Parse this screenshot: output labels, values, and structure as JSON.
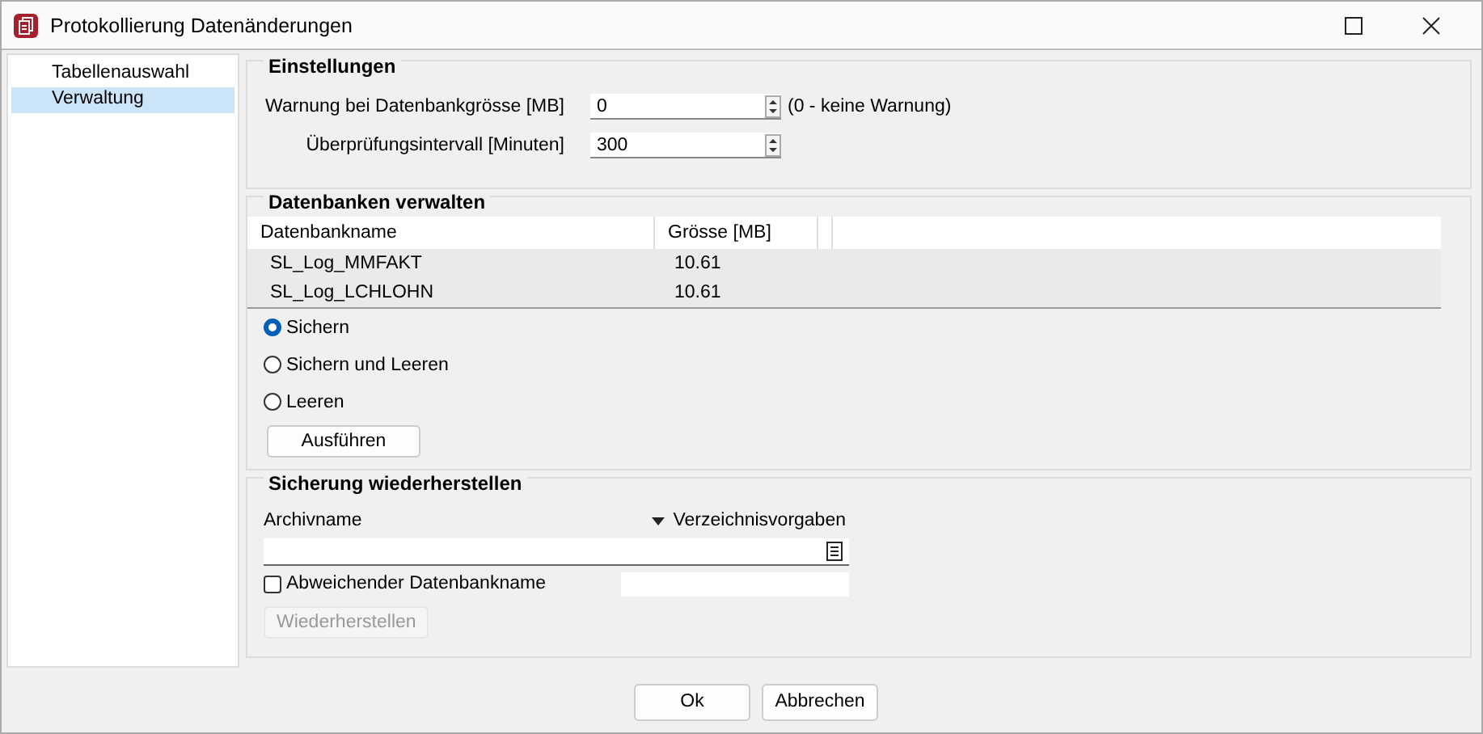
{
  "window": {
    "title": "Protokollierung Datenänderungen"
  },
  "sidebar": {
    "items": [
      {
        "label": "Tabellenauswahl",
        "selected": false
      },
      {
        "label": "Verwaltung",
        "selected": true
      }
    ]
  },
  "settings": {
    "title": "Einstellungen",
    "fields": [
      {
        "label": "Warnung bei Datenbankgrösse [MB]",
        "value": "0",
        "hint": "(0 - keine Warnung)"
      },
      {
        "label": "Überprüfungsintervall [Minuten]",
        "value": "300"
      }
    ]
  },
  "databases": {
    "title": "Datenbanken verwalten",
    "table": {
      "columns": [
        "Datenbankname",
        "Grösse [MB]"
      ],
      "rows": [
        [
          "SL_Log_MMFAKT",
          "10.61"
        ],
        [
          "SL_Log_LCHLOHN",
          "10.61"
        ]
      ]
    },
    "options": [
      {
        "label": "Sichern",
        "selected": true
      },
      {
        "label": "Sichern und Leeren",
        "selected": false
      },
      {
        "label": "Leeren",
        "selected": false
      }
    ],
    "button": {
      "label": "Ausführen",
      "disabled": false
    }
  },
  "restore": {
    "title": "Sicherung wiederherstellen",
    "archive_label": "Archivname",
    "directory_link": "Verzeichnisvorgaben",
    "checkbox": {
      "label": "Abweichender Datenbankname",
      "checked": false
    },
    "button": {
      "label": "Wiederherstellen",
      "disabled": true
    }
  },
  "buttons": [
    "Ok",
    "Abbrechen"
  ]
}
